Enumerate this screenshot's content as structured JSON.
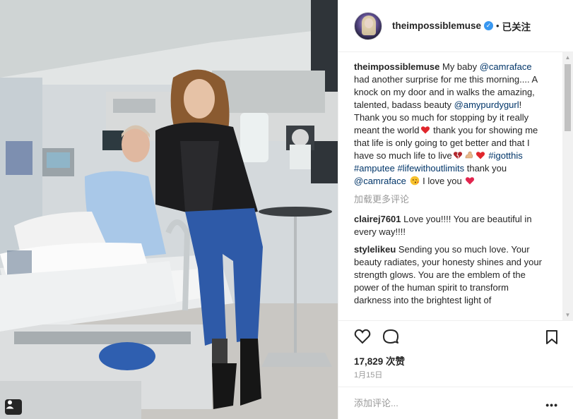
{
  "post": {
    "username": "theimpossiblemuse",
    "separator": "•",
    "follow_state": "已关注",
    "verified_glyph": "✓"
  },
  "caption": {
    "user": "theimpossiblemuse",
    "seg1": " My baby ",
    "mention1": "@camraface",
    "seg2": " had another surprise for me this morning.... A knock on my door and in walks the amazing, talented, badass beauty ",
    "mention2": "@amypurdygurl",
    "seg3": "! Thank you so much for stopping by it really meant the world",
    "seg4": " thank you for showing me that life is only going to get better and that I have so much life to live",
    "tag1": "#igotthis",
    "tag2": "#amputee",
    "tag3": "#lifewithoutlimits",
    "seg5": " thank you ",
    "mention3": "@camraface",
    "seg6": " I love you"
  },
  "load_more": "加载更多评论",
  "comments": [
    {
      "user": "clairej7601",
      "text": " Love you!!!! You are beautiful in every way!!!!"
    },
    {
      "user": "stylelikeu",
      "text": " Sending you so much love. Your beauty radiates, your honesty shines and your strength glows. You are the emblem of the power of the human spirit to transform darkness into the brightest light of"
    }
  ],
  "likes": "17,829 次赞",
  "date": "1月15日",
  "add_comment_placeholder": "添加评论...",
  "more_label": "•••",
  "icons": {
    "like": "heart-icon",
    "comment": "comment-icon",
    "save": "bookmark-icon",
    "tag": "user-tag-icon"
  },
  "colors": {
    "accent": "#3897f0",
    "mention": "#003569",
    "muted": "#999999",
    "text": "#262626"
  }
}
